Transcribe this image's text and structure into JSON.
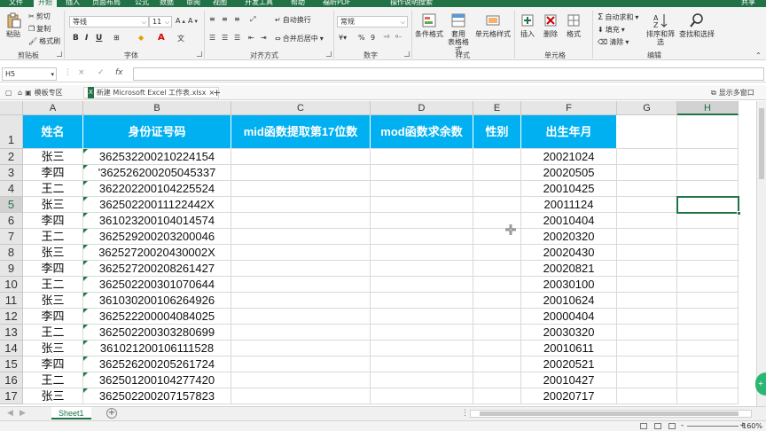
{
  "colors": {
    "excel_green": "#217346",
    "header_fill": "#00b0f0",
    "header_text": "#ffffff",
    "selection": "#217346"
  },
  "ribbon_tabs": [
    {
      "label": "文件"
    },
    {
      "label": "开始",
      "active": true
    },
    {
      "label": "插入"
    },
    {
      "label": "页面布局"
    },
    {
      "label": "公式"
    },
    {
      "label": "数据"
    },
    {
      "label": "审阅"
    },
    {
      "label": "视图"
    },
    {
      "label": "开发工具"
    },
    {
      "label": "帮助"
    },
    {
      "label": "福昕PDF"
    },
    {
      "label": "操作说明搜索"
    },
    {
      "label": "共享"
    }
  ],
  "ribbon": {
    "clipboard": {
      "paste": "粘贴",
      "cut": "剪切",
      "copy": "复制",
      "format_painter": "格式刷",
      "label": "剪贴板"
    },
    "font": {
      "font_name": "等线",
      "font_size": "11",
      "label": "字体",
      "bold": "B",
      "italic": "I",
      "underline": "U"
    },
    "alignment": {
      "wrap_text": "自动换行",
      "merge_center": "合并后居中",
      "label": "对齐方式"
    },
    "number": {
      "format": "常规",
      "percent": "%",
      "comma": "9",
      "label": "数字"
    },
    "styles": {
      "conditional": "条件格式",
      "table_format": "套用\n表格格式",
      "cell_styles": "单元格样式",
      "label": "样式"
    },
    "cells": {
      "insert": "插入",
      "delete": "删除",
      "format": "格式",
      "label": "单元格"
    },
    "editing": {
      "autosum": "自动求和",
      "fill": "填充",
      "clear": "清除",
      "sort_filter": "排序和筛选",
      "find_select": "查找和选择",
      "label": "编辑"
    }
  },
  "formula_bar": {
    "name_box": "H5",
    "cancel": "×",
    "enter": "✓",
    "fx": "fx",
    "formula": ""
  },
  "doc_tabs": {
    "template": "模板专区",
    "file": "新建 Microsoft Excel 工作表.xlsx",
    "close": "×",
    "add": "+",
    "multiwindow": "显示多窗口"
  },
  "columns": [
    "A",
    "B",
    "C",
    "D",
    "E",
    "F",
    "G",
    "H"
  ],
  "rows": [
    "1",
    "2",
    "3",
    "4",
    "5",
    "6",
    "7",
    "8",
    "9",
    "10",
    "11",
    "12",
    "13",
    "14",
    "15",
    "16",
    "17"
  ],
  "table_headers": [
    "姓名",
    "身份证号码",
    "mid函数提取第17位数",
    "mod函数求余数",
    "性别",
    "出生年月"
  ],
  "table_rows": [
    [
      "张三",
      "362532200210224154",
      "",
      "",
      "",
      "20021024"
    ],
    [
      "李四",
      "'362526200205045337",
      "",
      "",
      "",
      "20020505"
    ],
    [
      "王二",
      "362202200104225524",
      "",
      "",
      "",
      "20010425"
    ],
    [
      "张三",
      "36250220011122442X",
      "",
      "",
      "",
      "20011124"
    ],
    [
      "李四",
      "361023200104014574",
      "",
      "",
      "",
      "20010404"
    ],
    [
      "王二",
      "362529200203200046",
      "",
      "",
      "",
      "20020320"
    ],
    [
      "张三",
      "36252720020430002X",
      "",
      "",
      "",
      "20020430"
    ],
    [
      "李四",
      "362527200208261427",
      "",
      "",
      "",
      "20020821"
    ],
    [
      "王二",
      "362502200301070644",
      "",
      "",
      "",
      "20030100"
    ],
    [
      "张三",
      "361030200106264926",
      "",
      "",
      "",
      "20010624"
    ],
    [
      "李四",
      "362522200004084025",
      "",
      "",
      "",
      "20000404"
    ],
    [
      "王二",
      "362502200303280699",
      "",
      "",
      "",
      "20030320"
    ],
    [
      "张三",
      "361021200106111528",
      "",
      "",
      "",
      "20010611"
    ],
    [
      "李四",
      "362526200205261724",
      "",
      "",
      "",
      "20020521"
    ],
    [
      "王二",
      "362501200104277420",
      "",
      "",
      "",
      "20010427"
    ],
    [
      "张三",
      "362502200207157823",
      "",
      "",
      "",
      "20020717"
    ]
  ],
  "selected_cell": "H5",
  "sheet_tabs": {
    "sheet": "Sheet1",
    "add": "+"
  },
  "status": {
    "zoom": "160%",
    "zoom_minus": "-",
    "zoom_plus": "+"
  },
  "badge": "+"
}
